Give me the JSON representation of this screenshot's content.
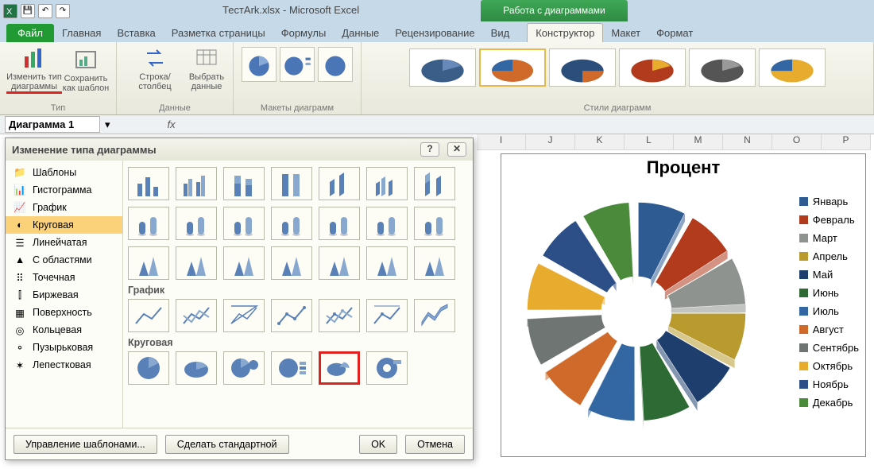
{
  "app": {
    "doc_name": "ТестArk.xlsx",
    "app_name": "Microsoft Excel",
    "chart_tools_title": "Работа с диаграммами"
  },
  "tabs": {
    "file": "Файл",
    "home": "Главная",
    "insert": "Вставка",
    "page_layout": "Разметка страницы",
    "formulas": "Формулы",
    "data": "Данные",
    "review": "Рецензирование",
    "view": "Вид",
    "design": "Конструктор",
    "layout": "Макет",
    "format": "Формат"
  },
  "ribbon": {
    "change_type": "Изменить тип диаграммы",
    "save_template": "Сохранить как шаблон",
    "type_group": "Тип",
    "switch_rowcol": "Строка/столбец",
    "select_data": "Выбрать данные",
    "data_group": "Данные",
    "layouts_group": "Макеты диаграмм",
    "styles_group": "Стили диаграмм"
  },
  "formula": {
    "name_box": "Диаграмма 1",
    "fx": "fx"
  },
  "columns": [
    "I",
    "J",
    "K",
    "L",
    "M",
    "N",
    "O",
    "P"
  ],
  "dialog": {
    "title": "Изменение типа диаграммы",
    "categories": [
      {
        "name": "Шаблоны",
        "icon": "folder"
      },
      {
        "name": "Гистограмма",
        "icon": "bar"
      },
      {
        "name": "График",
        "icon": "line"
      },
      {
        "name": "Круговая",
        "icon": "pie",
        "selected": true
      },
      {
        "name": "Линейчатая",
        "icon": "hbar"
      },
      {
        "name": "С областями",
        "icon": "area"
      },
      {
        "name": "Точечная",
        "icon": "scatter"
      },
      {
        "name": "Биржевая",
        "icon": "stock"
      },
      {
        "name": "Поверхность",
        "icon": "surface"
      },
      {
        "name": "Кольцевая",
        "icon": "donut"
      },
      {
        "name": "Пузырьковая",
        "icon": "bubble"
      },
      {
        "name": "Лепестковая",
        "icon": "radar"
      }
    ],
    "section_line": "График",
    "section_pie": "Круговая",
    "manage_templates": "Управление шаблонами...",
    "set_default": "Сделать стандартной",
    "ok": "OK",
    "cancel": "Отмена"
  },
  "chart_data": {
    "type": "pie",
    "title": "Процент",
    "series": [
      {
        "name": "Январь",
        "value": 8.33,
        "color": "#2f5b93"
      },
      {
        "name": "Февраль",
        "value": 8.33,
        "color": "#b13b1c"
      },
      {
        "name": "Март",
        "value": 8.33,
        "color": "#8f9390"
      },
      {
        "name": "Апрель",
        "value": 8.33,
        "color": "#b89a2e"
      },
      {
        "name": "Май",
        "value": 8.33,
        "color": "#1e3f6e"
      },
      {
        "name": "Июнь",
        "value": 8.33,
        "color": "#2e6a33"
      },
      {
        "name": "Июль",
        "value": 8.33,
        "color": "#3367a3"
      },
      {
        "name": "Август",
        "value": 8.33,
        "color": "#cf6a2a"
      },
      {
        "name": "Сентябрь",
        "value": 8.33,
        "color": "#6f7572"
      },
      {
        "name": "Октябрь",
        "value": 8.33,
        "color": "#e7ac2e"
      },
      {
        "name": "Ноябрь",
        "value": 8.33,
        "color": "#2b4f86"
      },
      {
        "name": "Декабрь",
        "value": 8.33,
        "color": "#4a8a3a"
      }
    ]
  }
}
